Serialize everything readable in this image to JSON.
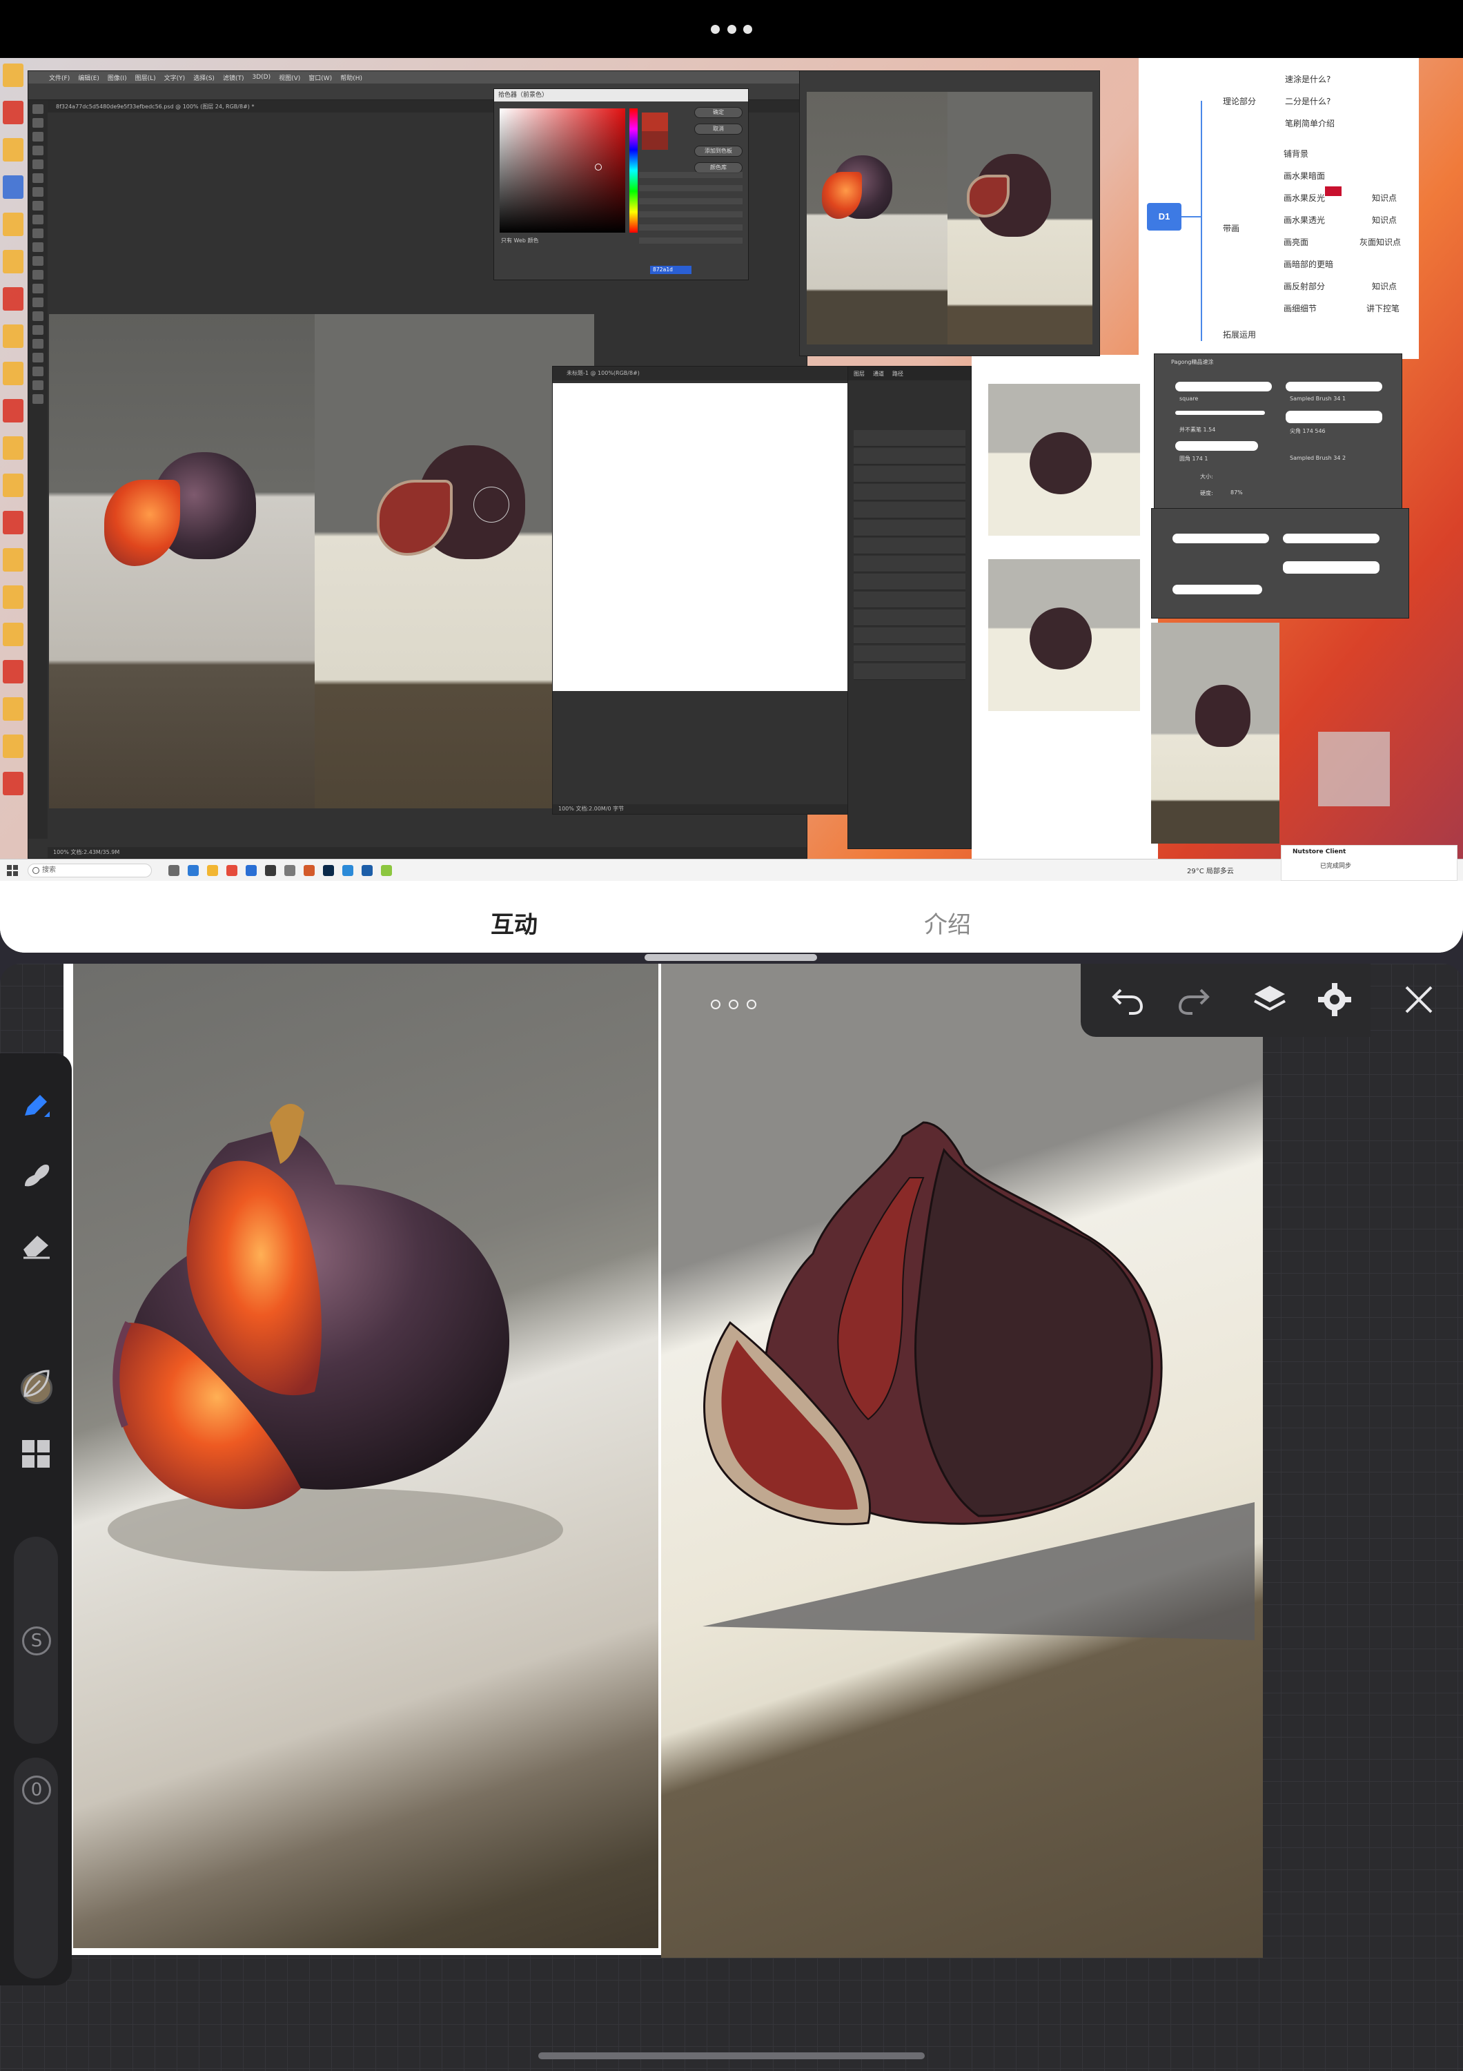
{
  "top_bar": {
    "more_icon": "more-dots-icon"
  },
  "desktop": {
    "photoshop_main": {
      "menu_items": [
        "文件(F)",
        "编辑(E)",
        "图像(I)",
        "图层(L)",
        "文字(Y)",
        "选择(S)",
        "滤镜(T)",
        "3D(D)",
        "视图(V)",
        "窗口(W)",
        "帮助(H)"
      ],
      "tab_label": "8f324a77dc5d5480de9e5f33efbedc56.psd @ 100% (图层 24, RGB/8#) *",
      "status": "100%   文档:2.43M/35.9M"
    },
    "color_picker": {
      "title": "拾色器（前景色）",
      "buttons": [
        "确定",
        "取消",
        "添加到色板",
        "颜色库"
      ],
      "web_only_label": "只有 Web 颜色",
      "hex_value": "872a1d"
    },
    "second_doc": {
      "title": "未标题-1 @ 100%(RGB/8#)",
      "status": "100%   文档:2.00M/0 字节"
    },
    "layers_panel": {
      "tabs": [
        "图层",
        "通道",
        "路径"
      ],
      "layer_count": 14
    },
    "mindmap": {
      "root": "D1",
      "branches": [
        {
          "label": "理论部分",
          "children": [
            "速涂是什么?",
            "二分是什么?",
            "笔刷简单介绍"
          ]
        },
        {
          "label": "带画",
          "children": [
            "铺背景",
            "画水果暗面",
            "画水果反光",
            "画水果透光",
            "画亮面",
            "画暗部的更暗",
            "画反射部分",
            "画细细节"
          ]
        },
        {
          "label": "拓展运用",
          "children": []
        }
      ],
      "side_notes": [
        "知识点",
        "知识点",
        "灰面知识点",
        "知识点",
        "讲下控笔"
      ]
    },
    "brush_panel": {
      "title": "Pagong精品速涂",
      "brushes": [
        "square",
        "Sampled Brush 34 1",
        "并不素笔 1.54",
        "尖角 174 546",
        "圆角 174 1",
        "Sampled Brush 34 2"
      ],
      "size_label": "大小:",
      "hardness_label": "硬度:",
      "hardness_value": "87%"
    },
    "taskbar": {
      "search_placeholder": "搜索",
      "weather": "29°C 局部多云"
    },
    "toast": {
      "app": "Nutstore Client",
      "message": "已完成同步"
    }
  },
  "tabs": {
    "interactive": "互动",
    "intro": "介绍"
  },
  "canvas_app": {
    "left_tools": [
      {
        "name": "pen",
        "icon": "pen-icon",
        "active": true
      },
      {
        "name": "smudge",
        "icon": "smudge-icon",
        "active": false
      },
      {
        "name": "eraser",
        "icon": "eraser-icon",
        "active": false
      },
      {
        "name": "color",
        "icon": "color-swatch",
        "active": false
      },
      {
        "name": "brush-library",
        "icon": "leaf-icon",
        "active": false
      },
      {
        "name": "gallery",
        "icon": "grid-icon",
        "active": false
      }
    ],
    "current_color": "#837359",
    "size_badge": "S",
    "opacity_badge": "0",
    "top_toolbar": [
      "undo-icon",
      "redo-icon",
      "layers-icon",
      "gear-icon",
      "close-icon"
    ],
    "accent_color": "#2f80ff"
  }
}
